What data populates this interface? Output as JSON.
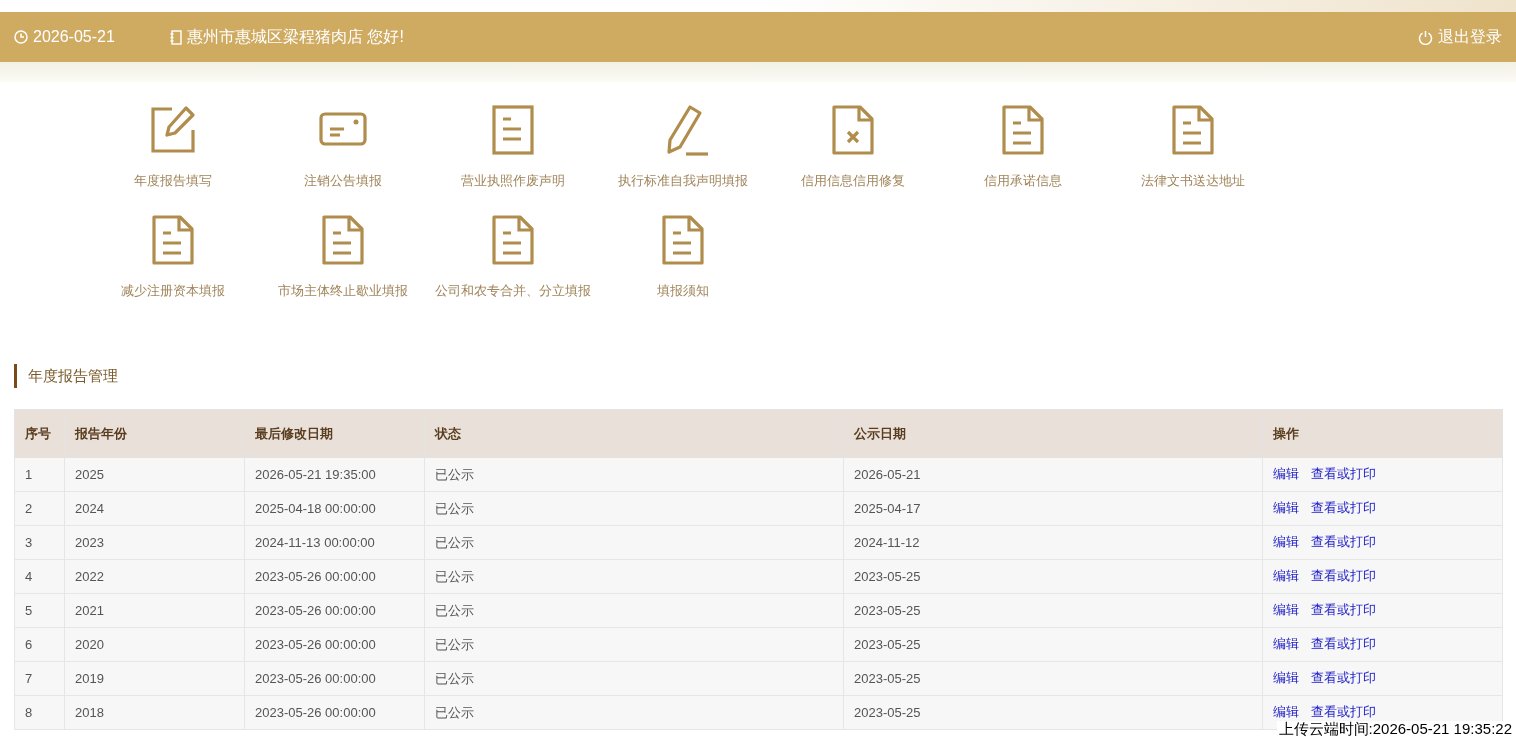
{
  "header": {
    "date": "2026-05-21",
    "greeting": "惠州市惠城区梁程猪肉店 您好!",
    "logout": "退出登录"
  },
  "shortcuts": [
    {
      "label": "年度报告填写",
      "kind": "edit"
    },
    {
      "label": "注销公告填报",
      "kind": "card"
    },
    {
      "label": "营业执照作废声明",
      "kind": "doc"
    },
    {
      "label": "执行标准自我声明填报",
      "kind": "pencil"
    },
    {
      "label": "信用信息信用修复",
      "kind": "doc-x"
    },
    {
      "label": "信用承诺信息",
      "kind": "doc-fold"
    },
    {
      "label": "法律文书送达地址",
      "kind": "doc-fold"
    },
    {
      "label": "减少注册资本填报",
      "kind": "doc-fold"
    },
    {
      "label": "市场主体终止歇业填报",
      "kind": "doc-fold"
    },
    {
      "label": "公司和农专合并、分立填报",
      "kind": "doc-fold"
    },
    {
      "label": "填报须知",
      "kind": "doc-fold"
    }
  ],
  "section_title": "年度报告管理",
  "table": {
    "columns": [
      "序号",
      "报告年份",
      "最后修改日期",
      "状态",
      "公示日期",
      "操作"
    ],
    "rows": [
      {
        "no": "1",
        "year": "2025",
        "modified": "2026-05-21 19:35:00",
        "status": "已公示",
        "published": "2026-05-21",
        "actions": [
          "编辑",
          "查看或打印"
        ]
      },
      {
        "no": "2",
        "year": "2024",
        "modified": "2025-04-18 00:00:00",
        "status": "已公示",
        "published": "2025-04-17",
        "actions": [
          "编辑",
          "查看或打印"
        ]
      },
      {
        "no": "3",
        "year": "2023",
        "modified": "2024-11-13 00:00:00",
        "status": "已公示",
        "published": "2024-11-12",
        "actions": [
          "编辑",
          "查看或打印"
        ]
      },
      {
        "no": "4",
        "year": "2022",
        "modified": "2023-05-26 00:00:00",
        "status": "已公示",
        "published": "2023-05-25",
        "actions": [
          "编辑",
          "查看或打印"
        ]
      },
      {
        "no": "5",
        "year": "2021",
        "modified": "2023-05-26 00:00:00",
        "status": "已公示",
        "published": "2023-05-25",
        "actions": [
          "编辑",
          "查看或打印"
        ]
      },
      {
        "no": "6",
        "year": "2020",
        "modified": "2023-05-26 00:00:00",
        "status": "已公示",
        "published": "2023-05-25",
        "actions": [
          "编辑",
          "查看或打印"
        ]
      },
      {
        "no": "7",
        "year": "2019",
        "modified": "2023-05-26 00:00:00",
        "status": "已公示",
        "published": "2023-05-25",
        "actions": [
          "编辑",
          "查看或打印"
        ]
      },
      {
        "no": "8",
        "year": "2018",
        "modified": "2023-05-26 00:00:00",
        "status": "已公示",
        "published": "2023-05-25",
        "actions": [
          "编辑",
          "查看或打印"
        ]
      }
    ]
  },
  "upload_stamp": "上传云端时间:2026-05-21 19:35:22"
}
